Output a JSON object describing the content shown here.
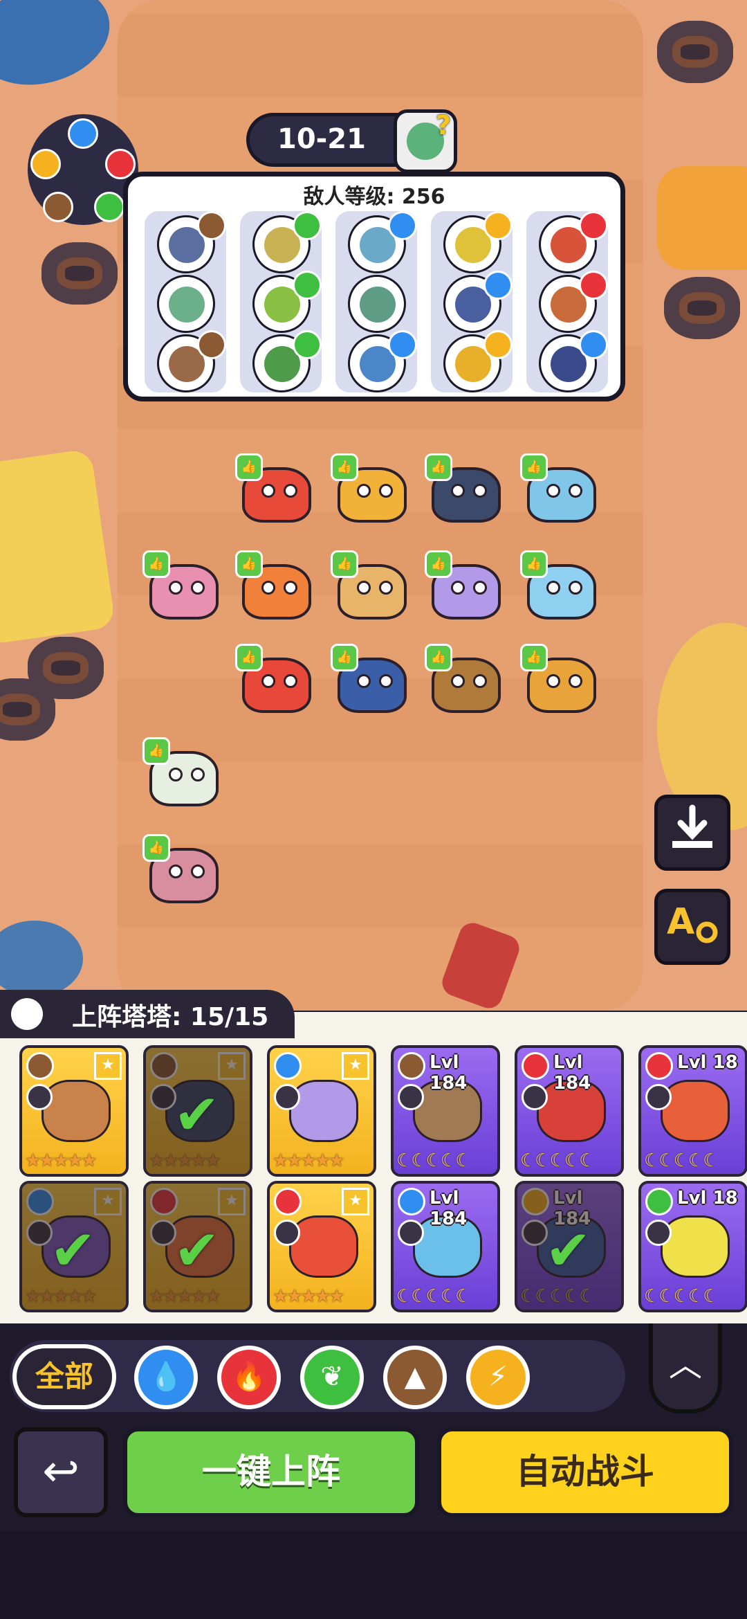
{
  "stage": {
    "level": "10-21"
  },
  "enemy_panel": {
    "title": "敌人等级: 256",
    "columns": [
      {
        "element": "earth",
        "enemies": [
          {
            "color": "#5a6fa0",
            "badge": "earth"
          },
          {
            "color": "#6cb08a",
            "badge": "none"
          },
          {
            "color": "#9a6a48",
            "badge": "earth"
          }
        ]
      },
      {
        "element": "leaf",
        "enemies": [
          {
            "color": "#c9b254",
            "badge": "leaf"
          },
          {
            "color": "#8ac043",
            "badge": "leaf"
          },
          {
            "color": "#4e9c4a",
            "badge": "leaf"
          }
        ]
      },
      {
        "element": "water",
        "enemies": [
          {
            "color": "#6aa9c8",
            "badge": "water"
          },
          {
            "color": "#5e9c86",
            "badge": "none"
          },
          {
            "color": "#4a86c8",
            "badge": "water"
          }
        ]
      },
      {
        "element": "lightning",
        "enemies": [
          {
            "color": "#e0c23a",
            "badge": "lightning"
          },
          {
            "color": "#4a5fa0",
            "badge": "water"
          },
          {
            "color": "#e8b02a",
            "badge": "lightning"
          }
        ]
      },
      {
        "element": "fire",
        "enemies": [
          {
            "color": "#d8533a",
            "badge": "fire"
          },
          {
            "color": "#c96a3a",
            "badge": "fire"
          },
          {
            "color": "#3a4a8a",
            "badge": "water"
          }
        ]
      }
    ]
  },
  "element_colors": {
    "water": "#2f8ef0",
    "fire": "#e8333a",
    "leaf": "#3fbf3f",
    "earth": "#8b5a32",
    "lightning": "#f5b21e"
  },
  "deployed_creatures": [
    {
      "color": "#e84a3a"
    },
    {
      "color": "#f2b23a"
    },
    {
      "color": "#3b4a6a"
    },
    {
      "color": "#7fc6e8"
    },
    {
      "color": "#e98fb0"
    },
    {
      "color": "#f0803a"
    },
    {
      "color": "#e8b46a"
    },
    {
      "color": "#b39ae8"
    },
    {
      "color": "#8fd0f0"
    },
    {
      "color": "#e8483a"
    },
    {
      "color": "#3a5fa8"
    },
    {
      "color": "#b07a3a"
    },
    {
      "color": "#e8a43a"
    },
    {
      "color": "#e6efe0"
    },
    {
      "color": "#d98ea0"
    }
  ],
  "roster": {
    "label": "上阵塔塔: 15/15",
    "cards": [
      {
        "style": "gold",
        "element": "earth",
        "lvl": "",
        "starred": true,
        "selected": false,
        "color": "#c9834a",
        "rating": "stars"
      },
      {
        "style": "gold",
        "element": "earth",
        "lvl": "",
        "starred": true,
        "selected": true,
        "color": "#3b4a6a",
        "rating": "stars"
      },
      {
        "style": "gold",
        "element": "water",
        "lvl": "",
        "starred": true,
        "selected": false,
        "color": "#b39ae8",
        "rating": "stars"
      },
      {
        "style": "purple",
        "element": "earth",
        "lvl": "Lvl 184",
        "starred": false,
        "selected": false,
        "color": "#a07a52",
        "rating": "moons"
      },
      {
        "style": "purple",
        "element": "fire",
        "lvl": "Lvl 184",
        "starred": false,
        "selected": false,
        "color": "#d8403a",
        "rating": "moons"
      },
      {
        "style": "purple",
        "element": "fire",
        "lvl": "Lvl 18",
        "starred": false,
        "selected": false,
        "color": "#e8603a",
        "rating": "moons"
      },
      {
        "style": "gold",
        "element": "water",
        "lvl": "",
        "starred": true,
        "selected": true,
        "color": "#7a5ac0",
        "rating": "stars"
      },
      {
        "style": "gold",
        "element": "fire",
        "lvl": "",
        "starred": true,
        "selected": true,
        "color": "#e8703a",
        "rating": "stars"
      },
      {
        "style": "gold",
        "element": "fire",
        "lvl": "",
        "starred": true,
        "selected": false,
        "color": "#e8503a",
        "rating": "stars"
      },
      {
        "style": "purple",
        "element": "water",
        "lvl": "Lvl 184",
        "starred": false,
        "selected": false,
        "color": "#6ac0e8",
        "rating": "moons"
      },
      {
        "style": "purple",
        "element": "lightning",
        "lvl": "Lvl 184",
        "starred": false,
        "selected": true,
        "color": "#3a5fa8",
        "rating": "moons"
      },
      {
        "style": "purple",
        "element": "leaf",
        "lvl": "Lvl 18",
        "starred": false,
        "selected": false,
        "color": "#f0e04a",
        "rating": "moons"
      }
    ]
  },
  "filters": {
    "all_label": "全部",
    "elements": [
      "water",
      "fire",
      "leaf",
      "earth",
      "lightning"
    ]
  },
  "actions": {
    "deploy_label": "一键上阵",
    "auto_battle_label": "自动战斗"
  },
  "side_buttons": {
    "download_icon": "download-tray-icon",
    "auto_settings_icon": "auto-settings-icon"
  }
}
